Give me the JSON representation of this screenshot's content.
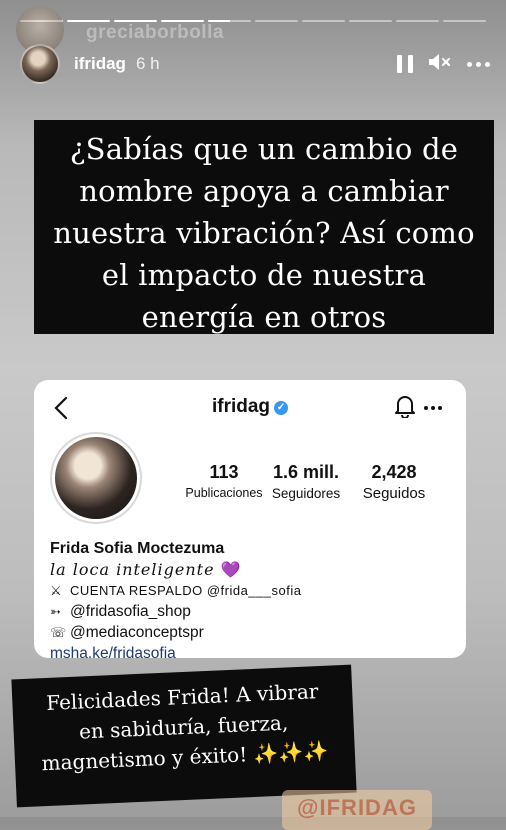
{
  "story": {
    "progress_fractions": [
      1,
      1,
      1,
      1,
      0.5,
      0,
      0,
      0,
      0,
      0
    ],
    "previous_username": "greciaborbolla",
    "username": "ifridag",
    "time": "6 h"
  },
  "caption": {
    "lines": [
      "¿Sabías que un cambio de",
      "nombre apoya a cambiar",
      "nuestra vibración? Así como",
      "el impacto de nuestra",
      "energía en otros"
    ]
  },
  "profile_card": {
    "username": "ifridag",
    "stats": [
      {
        "value": "113",
        "label": "Publicaciones"
      },
      {
        "value": "1.6 mill.",
        "label": "Seguidores"
      },
      {
        "value": "2,428",
        "label": "Seguidos"
      }
    ],
    "name": "Frida Sofia Moctezuma",
    "tagline": "la loca inteligente",
    "tagline_emoji": "💜",
    "bio_lines": [
      {
        "symbol": "⚔",
        "text": "CUENTA RESPALDO @frida___sofia"
      },
      {
        "symbol": "➳",
        "text": "@fridasofia_shop"
      },
      {
        "symbol": "☏",
        "text": "@mediaconceptspr"
      }
    ],
    "link": "msha.ke/fridasofia"
  },
  "sticker": {
    "lines": [
      "Felicidades Frida! A vibrar",
      "en sabiduría, fuerza,",
      "magnetismo y éxito!"
    ],
    "emoji": "✨✨✨"
  },
  "mention": "@IFRIDAG",
  "colors": {
    "verified": "#3897f0",
    "caption_bg": "#0c0c0c"
  }
}
